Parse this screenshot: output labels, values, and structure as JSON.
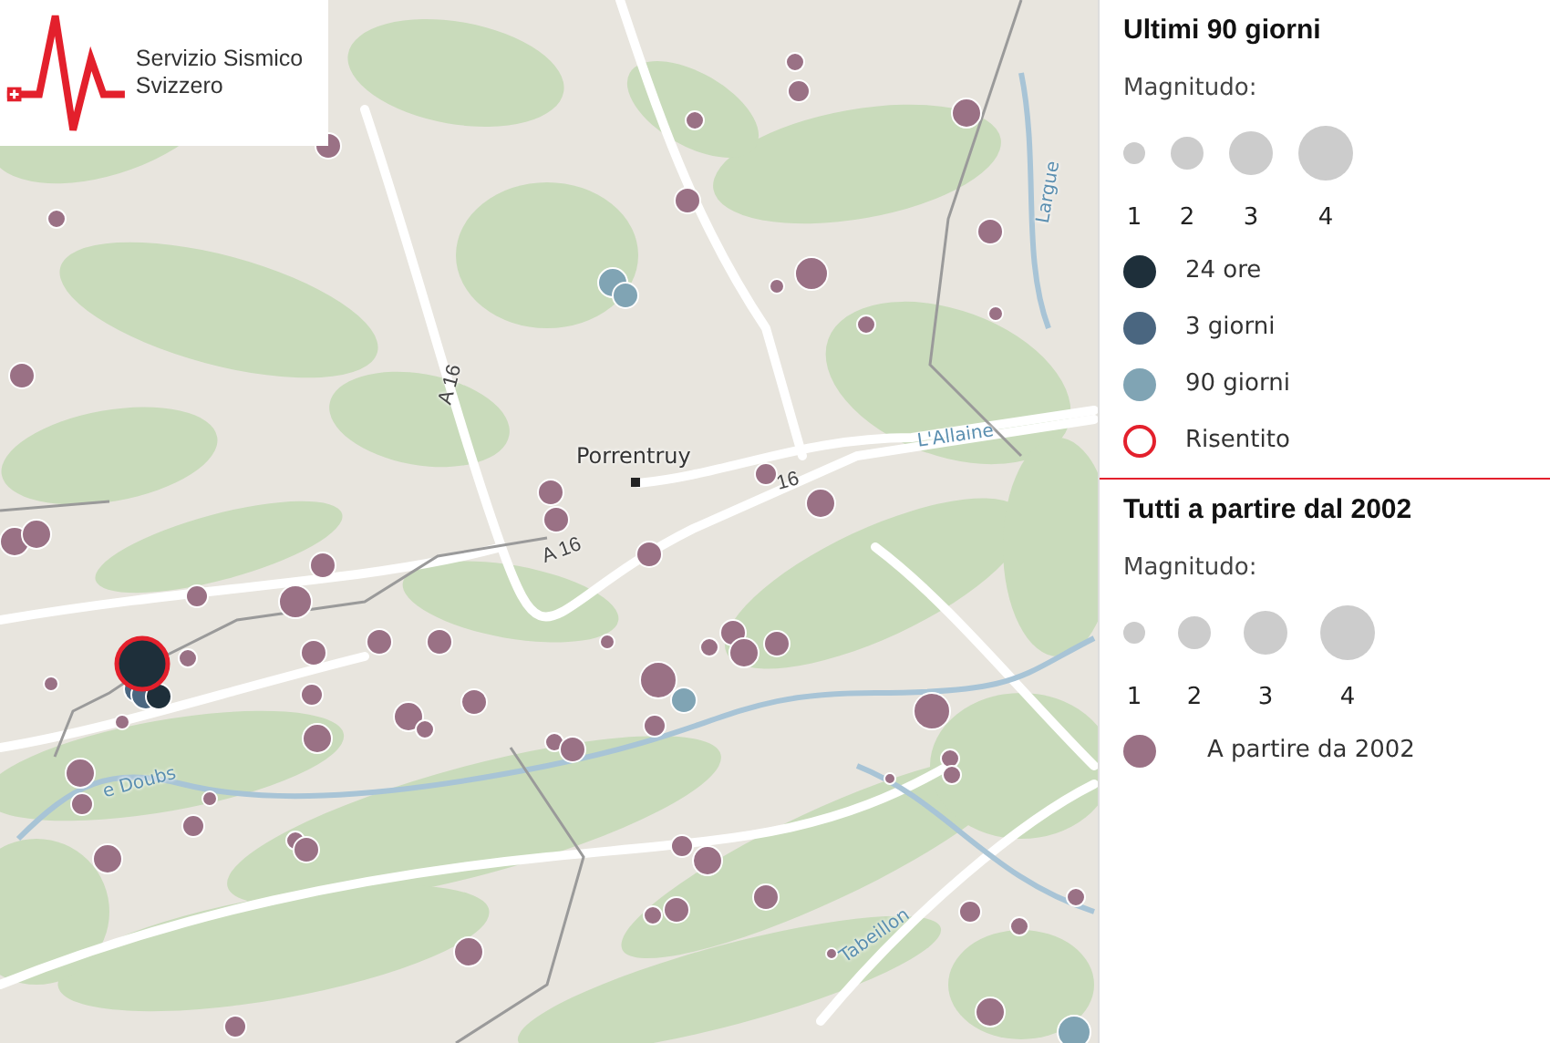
{
  "logo": {
    "text": "Servizio Sismico Svizzero"
  },
  "map": {
    "labels": [
      "Porrentruy",
      "A 16",
      "A 16",
      "16",
      "L'Allaine",
      "Largue",
      "e Doubs",
      "Tabeillon"
    ]
  },
  "legend_recent": {
    "title": "Ultimi 90 giorni",
    "magnitude_label": "Magnitudo:",
    "sizes": [
      "1",
      "2",
      "3",
      "4"
    ],
    "items": [
      {
        "label": "24 ore",
        "color": "#1e2f3a",
        "kind": "fill"
      },
      {
        "label": "3 giorni",
        "color": "#4a6680",
        "kind": "fill"
      },
      {
        "label": "90 giorni",
        "color": "#80a4b4",
        "kind": "fill"
      },
      {
        "label": "Risentito",
        "color": "#e3202c",
        "kind": "ring"
      }
    ]
  },
  "legend_all": {
    "title": "Tutti a partire dal 2002",
    "magnitude_label": "Magnitudo:",
    "sizes": [
      "1",
      "2",
      "3",
      "4"
    ],
    "items": [
      {
        "label": "A partire da 2002",
        "color": "#9a7185",
        "kind": "fill"
      }
    ]
  }
}
